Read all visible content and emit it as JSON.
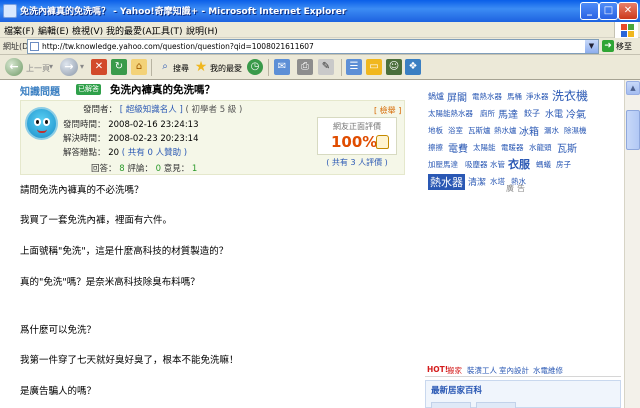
{
  "window": {
    "title": "免洗內褲真的免洗嗎？ - Yahoo!奇摩知識+ - Microsoft Internet Explorer",
    "minimize": "_",
    "maximize": "□",
    "close": "✕"
  },
  "menu": [
    "檔案(F)",
    "編輯(E)",
    "檢視(V)",
    "我的最愛(A)",
    "工具(T)",
    "說明(H)"
  ],
  "address": {
    "label": "網址(D)",
    "url": "http://tw.knowledge.yahoo.com/question/question?qid=1008021611607",
    "go_label": "移至"
  },
  "toolbar": {
    "back_label": "上一頁",
    "search_label": "搜尋",
    "favorites_label": "我的最愛"
  },
  "question": {
    "section": "知識問題",
    "badge": "已解答",
    "title": "免洗內褲真的免洗嗎？",
    "asker_label": "發問者：",
    "asker_name": "[ 超級知識名人 ]",
    "asker_level": "( 初學者 5 級 )",
    "report": "[ 檢舉 ]",
    "asked_label": "發問時間：",
    "asked_time": "2008-02-16 23:24:13",
    "solved_label": "解決時間：",
    "solved_time": "2008-02-23 20:23:14",
    "points_label": "解答贈點：",
    "points_value": "20",
    "points_sponsor": "( 共有 0 人贊助 )",
    "answers_label": "回答：",
    "answers": "8",
    "comments_label": "評論：",
    "comments": "0",
    "opinions_label": "意見：",
    "opinions": "1",
    "rating_label": "網友正面評價",
    "rating_pct": "100%",
    "rating_count": "( 共有 3 人評價 )"
  },
  "body": [
    "請問免洗內褲真的不必洗嗎？",
    "我買了一套免洗內褲，裡面有六件。",
    "上面號稱\"免洗\"，這是什麼高科技的材質製造的？",
    "真的\"免洗\"嗎？是奈米高科技除臭布料嗎？",
    "爲什麼可以免洗？",
    "我第一件穿了七天就好臭好臭了，根本不能免洗嘛！",
    "是廣告騙人的嗎？"
  ],
  "tags": [
    "鍋爐",
    "屏閣",
    "電熱水器",
    "馬桶",
    "淨水器",
    "洗衣機",
    "太陽能熱水器",
    "廁所",
    "馬達",
    "餃子",
    "水電",
    "冷氣",
    "地板",
    "浴室",
    "瓦斯爐",
    "熱水爐",
    "冰箱",
    "漏水",
    "除濕機",
    "擦擦",
    "電費",
    "太陽能",
    "電暖器",
    "水龍頭",
    "瓦斯",
    "加壓馬達",
    "吸塵器",
    "水管",
    "衣服",
    "螞蟻",
    "房子",
    "熱水器",
    "清潔",
    "水塔",
    "熱水"
  ],
  "ad_label": "廣告",
  "hot": {
    "label": "HOT!",
    "links": [
      "搬家",
      "裝潢工人",
      "室內設計",
      "水電維修"
    ]
  },
  "latest_title": "最新居家百科"
}
